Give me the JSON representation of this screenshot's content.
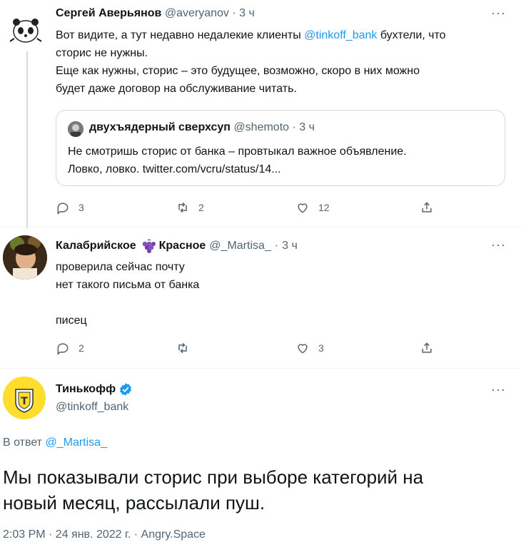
{
  "tweets": [
    {
      "author": "Сергей Аверьянов",
      "handle": "@averyanov",
      "time": "3 ч",
      "text_line1_pre": "Вот видите, а тут недавно недалекие клиенты ",
      "text_line1_link": "@tinkoff_bank",
      "text_line1_post": " бухтели, что",
      "text_line2": "сторис не нужны.",
      "text_line3": "Еще как нужны, сторис – это будущее, возможно, скоро в них можно",
      "text_line4": "будет даже договор на обслуживание читать.",
      "quote": {
        "author": "двухъядерный сверхсуп",
        "handle": "@shemoto",
        "time": "3 ч",
        "line1": "Не смотришь сторис от банка – провтыкал важное объявление.",
        "line2": "Ловко, ловко. twitter.com/vcru/status/14..."
      },
      "replies": "3",
      "retweets": "2",
      "likes": "12"
    },
    {
      "author_part1": "Калабрийское",
      "author_part2": "Красное",
      "handle": "@_Martisa_",
      "time": "3 ч",
      "line1": "проверила сейчас почту",
      "line2": "нет такого письма от банка",
      "line3": "писец",
      "replies": "2",
      "retweets": "",
      "likes": "3"
    }
  ],
  "main": {
    "author": "Тинькофф",
    "handle": "@tinkoff_bank",
    "reply_prefix": "В ответ",
    "reply_to": "@_Martisa_",
    "line1": "Мы показывали сторис при выборе категорий на",
    "line2": "новый месяц, рассылали пуш.",
    "meta": "2:03 PM · 24 янв. 2022 г. · Angry.Space"
  },
  "dot_sep": "·",
  "more_glyph": "···",
  "colors": {
    "accent": "#1d9bf0",
    "secondary": "#536471",
    "border": "#cfd9de"
  },
  "icons": [
    "reply-icon",
    "retweet-icon",
    "like-icon",
    "share-icon",
    "more-icon",
    "verified-icon",
    "grapes-icon"
  ]
}
